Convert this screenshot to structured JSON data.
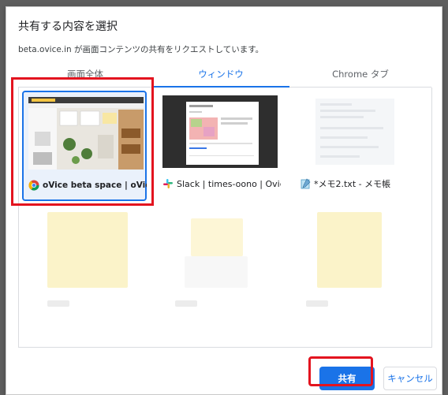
{
  "dialog": {
    "title": "共有する内容を選択",
    "subtitle": "beta.ovice.in が画面コンテンツの共有をリクエストしています。"
  },
  "tabs": [
    {
      "label": "画面全体",
      "active": false
    },
    {
      "label": "ウィンドウ",
      "active": true
    },
    {
      "label": "Chrome タブ",
      "active": false
    }
  ],
  "windows": [
    {
      "label": "oVice beta space | oVic...",
      "icon": "chrome-icon",
      "selected": true
    },
    {
      "label": "Slack | times-oono | Ovice",
      "icon": "slack-icon",
      "selected": false
    },
    {
      "label": "*メモ2.txt - メモ帳",
      "icon": "notepad-icon",
      "selected": false
    }
  ],
  "buttons": {
    "share": "共有",
    "cancel": "キャンセル"
  },
  "colors": {
    "accent": "#1a73e8",
    "highlight_frame": "#e3141f"
  }
}
